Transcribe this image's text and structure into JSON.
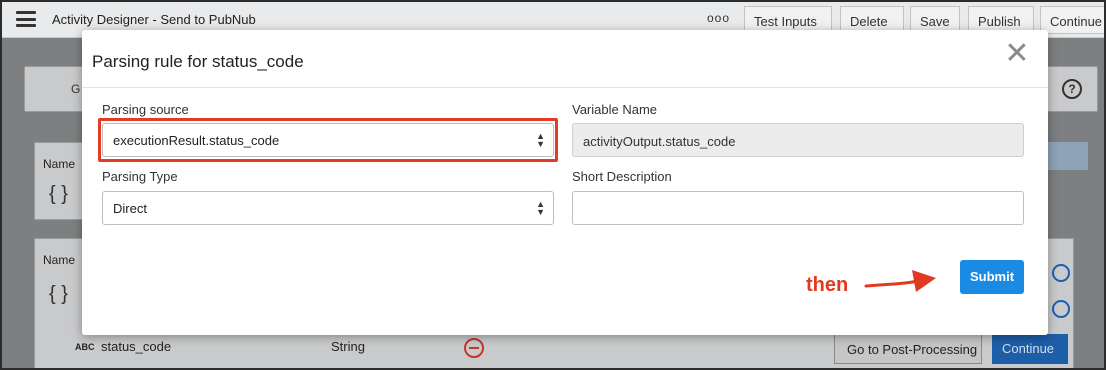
{
  "topbar": {
    "title": "Activity Designer - Send to PubNub",
    "more_glyph": "ooo",
    "buttons": [
      "Test Inputs",
      "Delete",
      "Save",
      "Publish",
      "Continue"
    ]
  },
  "background": {
    "card_letter": "G",
    "help_glyph": "?",
    "table1_header": "Name",
    "table1_brace": "{ }",
    "table2_header": "Name",
    "table2_brace": "{ }",
    "row": {
      "type_badge": "ABC",
      "name": "status_code",
      "type": "String"
    },
    "go_post_processing": "Go to Post-Processing",
    "continue": "Continue"
  },
  "modal": {
    "title": "Parsing rule for status_code",
    "close_glyph": "✕",
    "parsing_source": {
      "label": "Parsing source",
      "value": "executionResult.status_code"
    },
    "variable_name": {
      "label": "Variable Name",
      "value": "activityOutput.status_code"
    },
    "parsing_type": {
      "label": "Parsing Type",
      "value": "Direct"
    },
    "short_description": {
      "label": "Short Description",
      "value": ""
    },
    "submit": "Submit"
  },
  "annotation": {
    "then_text": "then",
    "color": "#e23a22"
  },
  "colors": {
    "accent": "#1a8be4",
    "highlight": "#e03c26"
  }
}
